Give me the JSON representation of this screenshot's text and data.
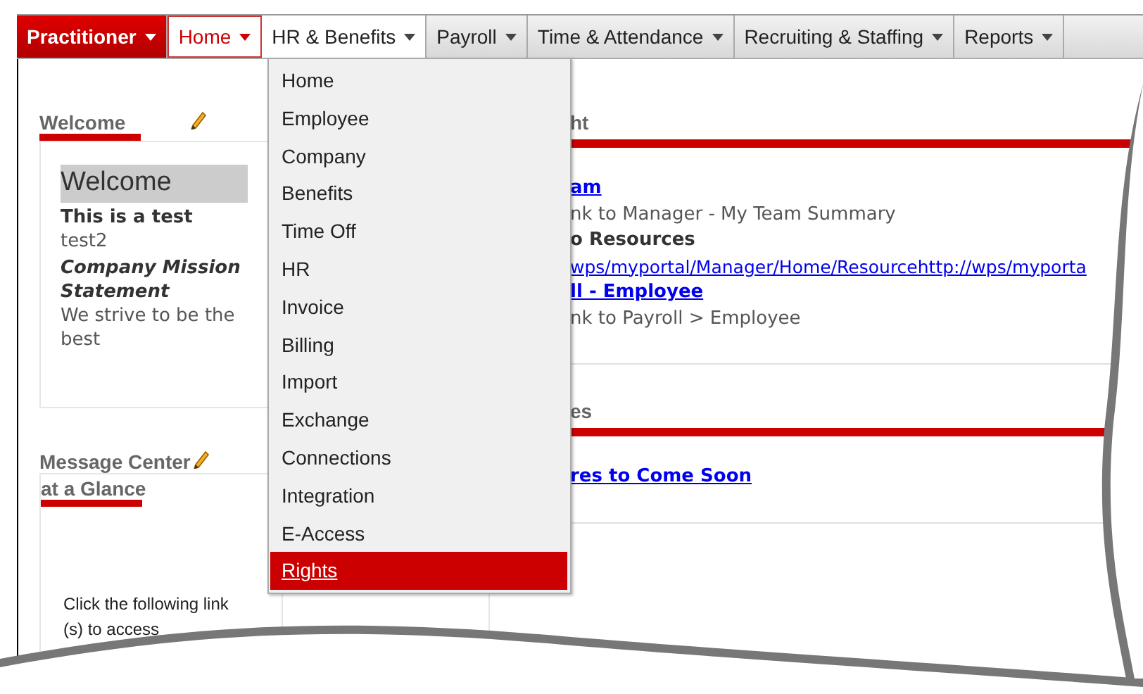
{
  "nav": {
    "tabs": [
      {
        "label": "Practitioner",
        "kind": "role"
      },
      {
        "label": "Home",
        "kind": "tab",
        "selected": true,
        "open": false
      },
      {
        "label": "HR & Benefits",
        "kind": "tab",
        "selected": false,
        "open": true
      },
      {
        "label": "Payroll",
        "kind": "tab",
        "selected": false,
        "open": false
      },
      {
        "label": "Time & Attendance",
        "kind": "tab",
        "selected": false,
        "open": false
      },
      {
        "label": "Recruiting & Staffing",
        "kind": "tab",
        "selected": false,
        "open": false
      },
      {
        "label": "Reports",
        "kind": "tab",
        "selected": false,
        "open": false
      }
    ]
  },
  "dropdown": {
    "items": [
      {
        "label": "Home",
        "selected": false
      },
      {
        "label": "Employee",
        "selected": false
      },
      {
        "label": "Company",
        "selected": false
      },
      {
        "label": "Benefits",
        "selected": false
      },
      {
        "label": "Time Off",
        "selected": false
      },
      {
        "label": "HR",
        "selected": false
      },
      {
        "label": "Invoice",
        "selected": false
      },
      {
        "label": "Billing",
        "selected": false
      },
      {
        "label": "Import",
        "selected": false
      },
      {
        "label": "Exchange",
        "selected": false
      },
      {
        "label": "Connections",
        "selected": false
      },
      {
        "label": "Integration",
        "selected": false
      },
      {
        "label": "E-Access",
        "selected": false
      },
      {
        "label": "Rights",
        "selected": true
      }
    ]
  },
  "welcome": {
    "title": "Welcome",
    "banner": "Welcome",
    "lines": [
      {
        "kind": "heading",
        "text": "This is a test"
      },
      {
        "kind": "body",
        "text": "test2"
      },
      {
        "kind": "emphasis",
        "text": "Company Mission Statement"
      },
      {
        "kind": "body",
        "text": "We strive to be the best"
      }
    ]
  },
  "message_center": {
    "title": "Message Center",
    "subtitle": "at a Glance",
    "lines": [
      "Click the following link",
      "(s) to access"
    ]
  },
  "right_portlets": [
    {
      "title": "ht",
      "items": [
        {
          "kind": "link",
          "text": "am"
        },
        {
          "kind": "note",
          "text": "nk to Manager - My Team Summary"
        },
        {
          "kind": "label",
          "text": "o Resources"
        },
        {
          "kind": "url",
          "text": "wps/myportal/Manager/Home/Resourcehttp://wps/myporta"
        },
        {
          "kind": "link",
          "text": "ll - Employee"
        },
        {
          "kind": "note",
          "text": "nk to Payroll > Employee"
        }
      ]
    },
    {
      "title": "es",
      "items": [
        {
          "kind": "link",
          "text": "res to Come Soon"
        }
      ]
    }
  ]
}
